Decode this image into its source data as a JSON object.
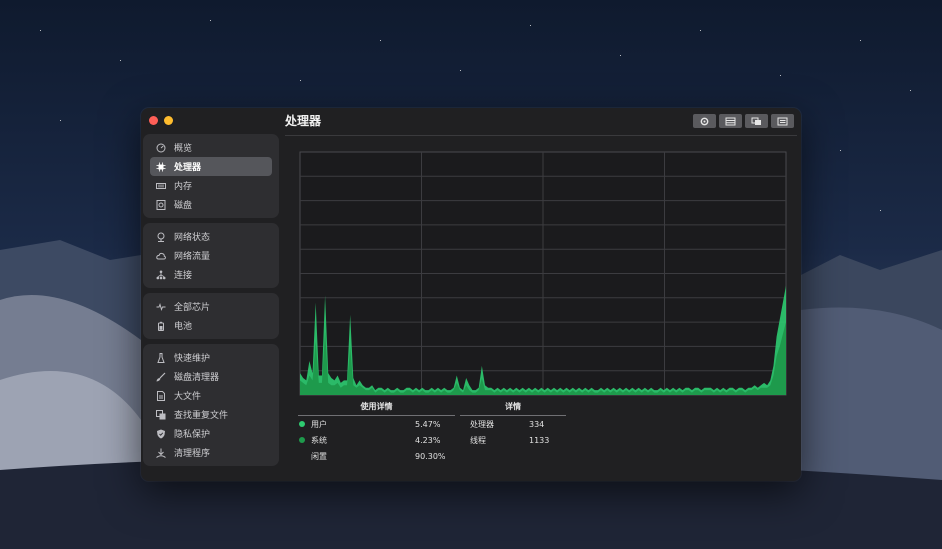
{
  "window": {
    "title": "处理器",
    "traffic_lights": [
      "close",
      "minimize"
    ]
  },
  "sidebar": {
    "groups": [
      {
        "items": [
          {
            "label": "概览",
            "icon": "gauge-icon"
          },
          {
            "label": "处理器",
            "icon": "cpu-icon",
            "active": true
          },
          {
            "label": "内存",
            "icon": "memory-icon"
          },
          {
            "label": "磁盘",
            "icon": "disk-icon"
          }
        ]
      },
      {
        "items": [
          {
            "label": "网络状态",
            "icon": "network-status-icon"
          },
          {
            "label": "网络流量",
            "icon": "cloud-icon"
          },
          {
            "label": "连接",
            "icon": "connections-icon"
          }
        ]
      },
      {
        "items": [
          {
            "label": "全部芯片",
            "icon": "pulse-icon"
          },
          {
            "label": "电池",
            "icon": "battery-icon"
          }
        ]
      },
      {
        "items": [
          {
            "label": "快速维护",
            "icon": "broom-icon"
          },
          {
            "label": "磁盘清理器",
            "icon": "brush-icon"
          },
          {
            "label": "大文件",
            "icon": "file-icon"
          },
          {
            "label": "查找重复文件",
            "icon": "duplicate-icon"
          },
          {
            "label": "隐私保护",
            "icon": "shield-icon"
          },
          {
            "label": "清理程序",
            "icon": "uninstall-icon"
          }
        ]
      }
    ]
  },
  "toolbar": {
    "buttons": [
      "settings-icon",
      "calendar-icon",
      "copy-icon",
      "list-icon"
    ]
  },
  "colors": {
    "user": "#2ecc71",
    "system": "#1e9a4c",
    "idle": "transparent"
  },
  "usage": {
    "title": "使用详情",
    "rows": [
      {
        "label": "用户",
        "value": "5.47%",
        "color": "#2ecc71"
      },
      {
        "label": "系统",
        "value": "4.23%",
        "color": "#1e9a4c"
      },
      {
        "label": "闲置",
        "value": "90.30%",
        "color": ""
      }
    ]
  },
  "details": {
    "title": "详情",
    "rows": [
      {
        "label": "处理器",
        "value": "334"
      },
      {
        "label": "线程",
        "value": "1133"
      }
    ]
  },
  "chart_data": {
    "type": "area",
    "ylim": [
      0,
      100
    ],
    "grid": true,
    "series": [
      {
        "values": [
          9,
          7,
          6,
          14,
          9,
          38,
          8,
          8,
          41,
          9,
          7,
          6,
          8,
          5,
          6,
          6,
          33,
          7,
          4,
          6,
          4,
          3,
          3,
          4,
          2,
          3,
          3,
          2,
          3,
          2,
          2,
          3,
          2,
          2,
          3,
          3,
          2,
          3,
          2,
          3,
          2,
          2,
          3,
          2,
          3,
          2,
          3,
          2,
          2,
          3,
          8,
          3,
          2,
          7,
          4,
          2,
          2,
          3,
          12,
          4,
          3,
          3,
          2,
          3,
          2,
          3,
          2,
          3,
          2,
          3,
          2,
          3,
          2,
          3,
          2,
          3,
          2,
          3,
          2,
          3,
          2,
          3,
          2,
          3,
          2,
          3,
          2,
          3,
          2,
          3,
          2,
          3,
          2,
          3,
          2,
          2,
          3,
          2,
          3,
          2,
          3,
          2,
          3,
          2,
          3,
          2,
          3,
          2,
          3,
          2,
          3,
          2,
          3,
          2,
          2,
          3,
          2,
          3,
          2,
          3,
          2,
          3,
          2,
          3,
          3,
          2,
          3,
          3,
          2,
          3,
          3,
          3,
          2,
          3,
          2,
          3,
          2,
          3,
          3,
          2,
          3,
          3,
          2,
          3,
          3,
          4,
          3,
          4,
          5,
          4,
          6,
          12,
          24,
          31,
          38,
          45
        ]
      },
      {
        "values": [
          6,
          5,
          4,
          8,
          6,
          22,
          5,
          5,
          26,
          5,
          4,
          4,
          5,
          3,
          4,
          4,
          20,
          4,
          3,
          4,
          3,
          2,
          2,
          3,
          1,
          2,
          2,
          1,
          2,
          1,
          1,
          2,
          1,
          1,
          2,
          2,
          1,
          2,
          1,
          2,
          1,
          1,
          2,
          1,
          2,
          1,
          2,
          1,
          1,
          2,
          5,
          2,
          1,
          4,
          2,
          1,
          1,
          2,
          7,
          2,
          2,
          2,
          1,
          2,
          1,
          2,
          1,
          2,
          1,
          2,
          1,
          2,
          1,
          2,
          1,
          2,
          1,
          2,
          1,
          2,
          1,
          2,
          1,
          2,
          1,
          2,
          1,
          2,
          1,
          2,
          1,
          2,
          1,
          2,
          1,
          1,
          2,
          1,
          2,
          1,
          2,
          1,
          2,
          1,
          2,
          1,
          2,
          1,
          2,
          1,
          2,
          1,
          2,
          1,
          1,
          2,
          1,
          2,
          1,
          2,
          1,
          2,
          1,
          2,
          2,
          1,
          2,
          2,
          1,
          2,
          2,
          2,
          1,
          2,
          1,
          2,
          1,
          2,
          2,
          1,
          2,
          2,
          1,
          2,
          2,
          3,
          2,
          3,
          3,
          3,
          4,
          8,
          16,
          20,
          25,
          30
        ]
      }
    ]
  }
}
